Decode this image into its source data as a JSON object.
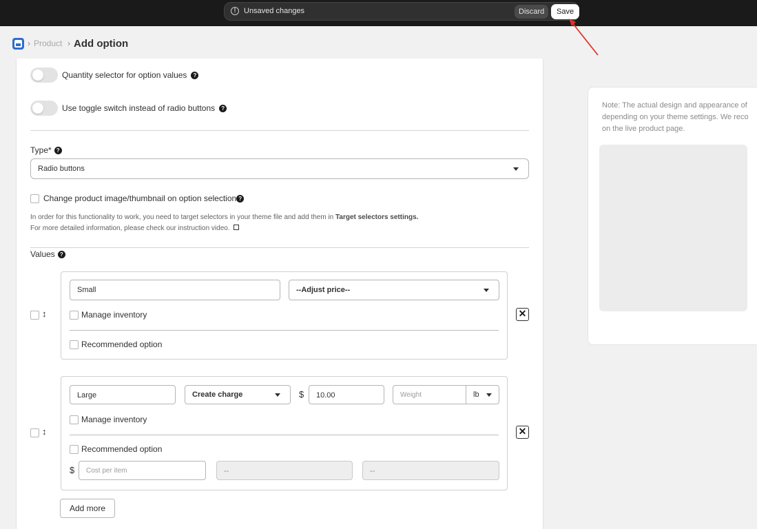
{
  "topbar": {
    "message": "Unsaved changes",
    "discard_label": "Discard",
    "save_label": "Save",
    "warn_glyph": "!"
  },
  "breadcrumb": {
    "product": "Product",
    "title": "Add option",
    "sep": "›"
  },
  "form": {
    "quantity_selector_label": "Quantity selector for option values",
    "toggle_switch_label": "Use toggle switch instead of radio buttons",
    "type_label": "Type*",
    "type_value": "Radio buttons",
    "change_image_label": "Change product image/thumbnail on option selection",
    "note_line1_prefix": "In order for this functionality to work, you need to target selectors in your theme file and add them in ",
    "note_line1_bold": "Target selectors settings.",
    "note_line2": "For more detailed information, please check our instruction video.",
    "values_label": "Values",
    "help_glyph": "?",
    "drag_glyph": "↕",
    "remove_glyph": "✕",
    "add_more_label": "Add more"
  },
  "values": [
    {
      "name": "Small",
      "price_mode": "--Adjust price--",
      "manage_inventory_label": "Manage inventory",
      "recommended_label": "Recommended option"
    },
    {
      "name": "Large",
      "price_mode": "Create charge",
      "currency": "$",
      "price": "10.00",
      "weight_placeholder": "Weight",
      "weight_unit": "lb",
      "manage_inventory_label": "Manage inventory",
      "recommended_label": "Recommended option",
      "cost_placeholder": "Cost per item",
      "disabled_field_1": "--",
      "disabled_field_2": "--"
    }
  ],
  "preview": {
    "note_line1": "Note: The actual design and appearance of",
    "note_line2": "depending on your theme settings. We reco",
    "note_line3": "on the live product page."
  },
  "colors": {
    "topbar_bg": "#1a1a1a",
    "arrow": "#e0322b"
  }
}
